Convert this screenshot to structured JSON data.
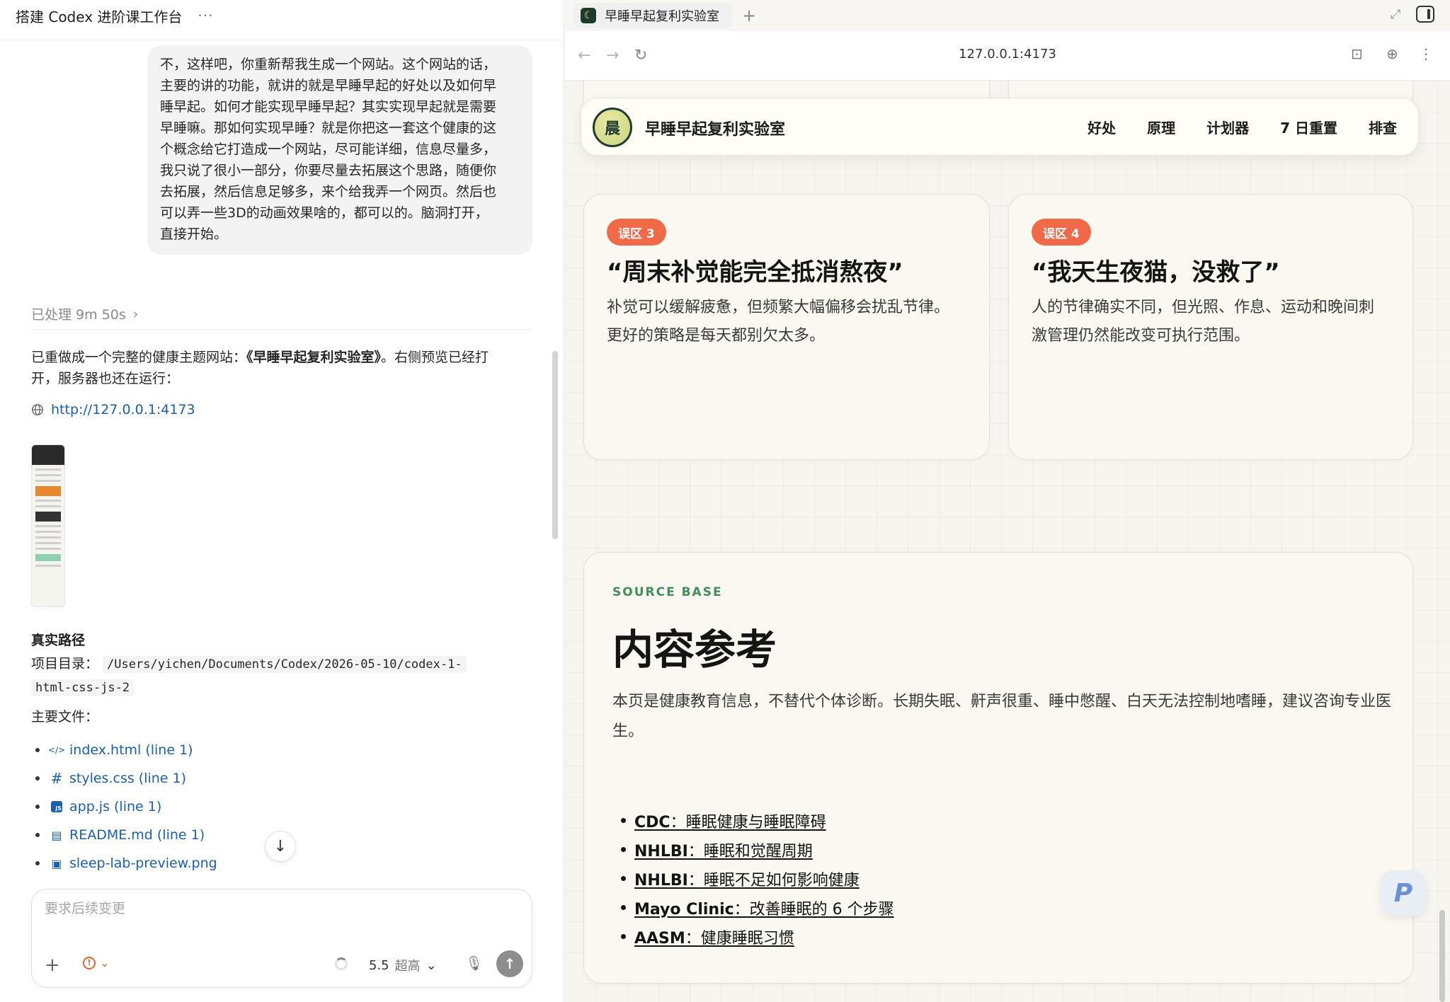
{
  "left": {
    "header_title": "搭建 Codex 进阶课工作台",
    "more_label": "···",
    "user_message_lines": [
      "不，这样吧，你重新帮我生成一个网站。这个网站的话，",
      "主要的讲的功能，就讲的就是早睡早起的好处以及如何早",
      "睡早起。如何才能实现早睡早起？其实实现早起就是需要",
      "早睡嘛。那如何实现早睡？就是你把这一套这个健康的这",
      "个概念给它打造成一个网站，尽可能详细，信息尽量多，",
      "我只说了很小一部分，你要尽量去拓展这个思路，随便你",
      "去拓展，然后信息足够多，来个给我弄一个网页。然后也",
      "可以弄一些3D的动画效果啥的，都可以的。脑洞打开，",
      "直接开始。"
    ],
    "processed_label": "已处理 9m 50s",
    "reply_prefix": "已重做成一个完整的健康主题网站：",
    "reply_site_name": "《早睡早起复利实验室》",
    "reply_suffix": "。右侧预览已经打",
    "reply_line2": "开，服务器也还在运行：",
    "reply_link": "http://127.0.0.1:4173",
    "path_title": "真实路径",
    "path_label": "项目目录：",
    "path_value_1": "/Users/yichen/Documents/Codex/2026-05-10/codex-1-",
    "path_value_2": "html-css-js-2",
    "files_label": "主要文件：",
    "files": [
      {
        "icon": "code-icon",
        "glyph": "</>",
        "name": "index.html (line 1)"
      },
      {
        "icon": "hash-icon",
        "glyph": "#",
        "name": "styles.css (line 1)"
      },
      {
        "icon": "js-file-icon",
        "glyph": "JS",
        "name": "app.js (line 1)"
      },
      {
        "icon": "document-icon",
        "glyph": "▤",
        "name": "README.md (line 1)"
      },
      {
        "icon": "image-icon",
        "glyph": "▣",
        "name": "sleep-lab-preview.png"
      }
    ],
    "composer_placeholder": "要求后续变更",
    "model": "5.5",
    "effort": "超高"
  },
  "browser": {
    "tab_title": "早睡早起复利实验室",
    "url": "127.0.0.1:4173"
  },
  "site": {
    "logo_char": "晨",
    "brand": "早睡早起复利实验室",
    "nav_links": [
      "好处",
      "原理",
      "计划器",
      "7 日重置",
      "排查"
    ],
    "myths": [
      {
        "badge": "误区 3",
        "title": "“周末补觉能完全抵消熬夜”",
        "body": "补觉可以缓解疲惫，但频繁大幅偏移会扰乱节律。更好的策略是每天都别欠太多。"
      },
      {
        "badge": "误区 4",
        "title": "“我天生夜猫，没救了”",
        "body": "人的节律确实不同，但光照、作息、运动和晚间刺激管理仍然能改变可执行范围。"
      }
    ],
    "source": {
      "kicker": "SOURCE BASE",
      "title": "内容参考",
      "description": "本页是健康教育信息，不替代个体诊断。长期失眠、鼾声很重、睡中憋醒、白天无法控制地嗜睡，建议咨询专业医生。",
      "refs": [
        {
          "org": "CDC",
          "text": "：睡眠健康与睡眠障碍"
        },
        {
          "org": "NHLBI",
          "text": "：睡眠和觉醒周期"
        },
        {
          "org": "NHLBI",
          "text": "：睡眠不足如何影响健康"
        },
        {
          "org": "Mayo Clinic",
          "text": "：改善睡眠的 6 个步骤"
        },
        {
          "org": "AASM",
          "text": "：健康睡眠习惯"
        }
      ]
    },
    "fab_label": "P"
  },
  "colors": {
    "link_blue": "#1a5fb4",
    "badge_coral": "#f06a4a",
    "kicker_green": "#3e8f5a",
    "page_bg": "#f7f5ef"
  }
}
